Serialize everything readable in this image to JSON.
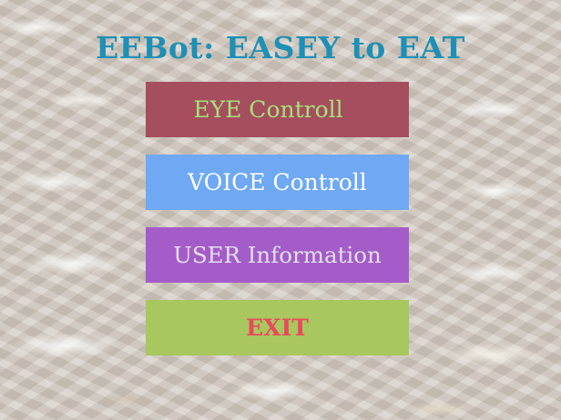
{
  "app": {
    "title": "EEBot: EASEY to EAT"
  },
  "menu": {
    "eye_label": "EYE Controll",
    "voice_label": "VOICE Controll",
    "user_label": "USER Information",
    "exit_label": "EXIT"
  },
  "colors": {
    "title": "#1e8fb5",
    "eye_bg": "#a54e5e",
    "eye_text": "#a8e07a",
    "voice_bg": "#6fa8f3",
    "voice_text": "#ffffff",
    "user_bg": "#a45cc9",
    "user_text": "#e3e0ea",
    "exit_bg": "#a8c75e",
    "exit_text": "#e8495d"
  }
}
